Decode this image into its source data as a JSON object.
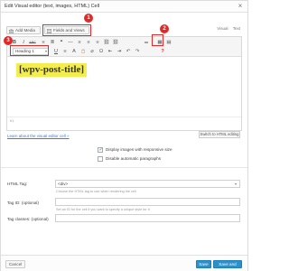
{
  "dialog": {
    "title": "Edit Visual editor (text, images, HTML) Cell",
    "close_glyph": "×"
  },
  "media": {
    "add_media_label": "Add Media",
    "fields_views_label": "Fields and Views"
  },
  "annotations": {
    "badge1": "1",
    "badge2": "2",
    "badge3": "3",
    "color": "#e02a2a"
  },
  "editor_tabs": {
    "visual": "Visual",
    "text": "Text"
  },
  "toolbar": {
    "row1_icons": [
      "bold-icon",
      "italic-icon",
      "strikethrough-icon",
      "bullet-list-icon",
      "numbered-list-icon",
      "blockquote-icon",
      "horizontal-rule-icon",
      "align-left-icon",
      "align-center-icon",
      "align-right-icon",
      "link-icon",
      "unlink-icon",
      "more-tag-icon",
      "table-icon",
      "toolbar-toggle-icon"
    ],
    "row1_glyphs": [
      "B",
      "I",
      "ABC",
      "≡",
      "≣",
      "❝",
      "—",
      "≡",
      "≡",
      "≡",
      "⛓",
      "⛓",
      "⚌",
      "▦",
      "▤"
    ],
    "format_select": "Heading 1",
    "row2_icons": [
      "underline-icon",
      "justify-icon",
      "text-color-icon",
      "paste-text-icon",
      "clear-format-icon",
      "special-char-icon",
      "outdent-icon",
      "indent-icon",
      "undo-icon",
      "redo-icon",
      "help-icon"
    ],
    "row2_glyphs": [
      "U",
      "≡",
      "A",
      "📋",
      "⌀",
      "Ω",
      "⇤",
      "⇥",
      "↶",
      "↷",
      "?"
    ]
  },
  "content": {
    "post_title": "[wpv-post-title]",
    "path": "h1",
    "highlight_color": "#f3ee4e"
  },
  "links": {
    "learn_more": "Learn about the visual editor cell »",
    "switch_html": "Switch to HTML editing"
  },
  "options": {
    "responsive_images": {
      "label": "Display images with responsive size",
      "checked": true
    },
    "disable_paragraphs": {
      "label": "Disable automatic paragraphs",
      "checked": false
    }
  },
  "form": {
    "html_tag": {
      "label": "HTML Tag:",
      "value": "<div>",
      "help": "Choose the HTML tag to use when rendering the cell"
    },
    "tag_id": {
      "label": "Tag ID: (optional)",
      "value": "",
      "help": "Set an ID for the cell if you want to specify a unique style for it"
    },
    "tag_classes": {
      "label": "Tag classes: (optional)",
      "value": ""
    }
  },
  "footer": {
    "cancel": "Cancel",
    "save": "Save",
    "save_close": "Save and close"
  }
}
